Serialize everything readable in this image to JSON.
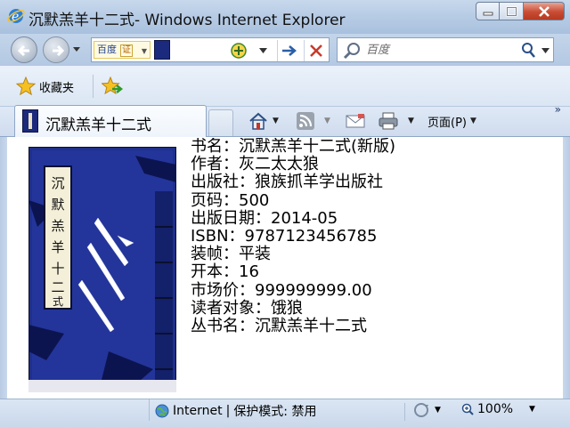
{
  "window": {
    "title": "沉默羔羊十二式",
    "title_suffix": "- Windows Internet Explorer"
  },
  "address_bar": {
    "search_provider_chip": "百度",
    "chip_badge": "证",
    "url_value": "",
    "compat_icon": "compatibility-view-icon",
    "go_icon": "go-arrow-icon",
    "stop_icon": "stop-icon"
  },
  "search": {
    "placeholder": "百度"
  },
  "favorites_bar": {
    "favorites_label": "收藏夹"
  },
  "tab": {
    "label": "沉默羔羊十二式"
  },
  "command_bar": {
    "page_label": "页面(P)"
  },
  "book": {
    "cover_title": "沉默羔羊十二式",
    "details": [
      "书名：沉默羔羊十二式(新版)",
      "作者：灰二太太狼",
      "出版社：狼族抓羊学出版社",
      "页码：500",
      "出版日期：2014-05",
      "ISBN：9787123456785",
      "装帧：平装",
      "开本：16",
      "市场价：999999999.00",
      "读者对象：饿狼",
      "丛书名：沉默羔羊十二式"
    ]
  },
  "status": {
    "zone": "Internet",
    "separator": "|",
    "protected_mode": "保护模式: 禁用",
    "zoom": "100%"
  },
  "colors": {
    "cover_blue": "#1f2f8c",
    "title_bar": "#b6cbe4",
    "close_red": "#c84b33"
  }
}
